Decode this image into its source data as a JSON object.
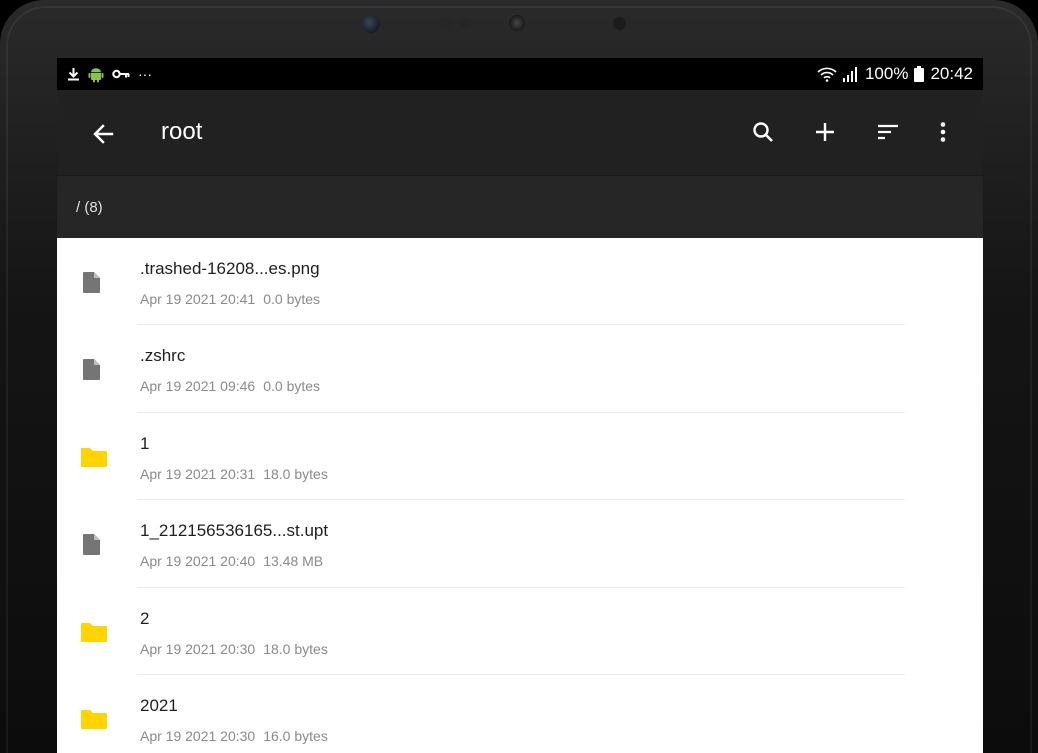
{
  "status_bar": {
    "battery": "100%",
    "time": "20:42",
    "overflow": "···"
  },
  "toolbar": {
    "title": "root"
  },
  "path": {
    "label": "/ (8)"
  },
  "files": [
    {
      "name": ".trashed-16208...es.png",
      "date": "Apr 19 2021 20:41",
      "size": "0.0 bytes",
      "type": "file"
    },
    {
      "name": ".zshrc",
      "date": "Apr 19 2021 09:46",
      "size": "0.0 bytes",
      "type": "file"
    },
    {
      "name": "1",
      "date": "Apr 19 2021 20:31",
      "size": "18.0 bytes",
      "type": "folder"
    },
    {
      "name": "1_212156536165...st.upt",
      "date": "Apr 19 2021 20:40",
      "size": "13.48 MB",
      "type": "file"
    },
    {
      "name": "2",
      "date": "Apr 19 2021 20:30",
      "size": "18.0 bytes",
      "type": "folder"
    },
    {
      "name": "2021",
      "date": "Apr 19 2021 20:30",
      "size": "16.0 bytes",
      "type": "folder"
    }
  ],
  "icons": {
    "back": "arrow-back-icon",
    "search": "search-icon",
    "add": "add-icon",
    "sort": "sort-icon",
    "more": "more-vert-icon",
    "file": "file-icon",
    "folder": "folder-icon"
  },
  "colors": {
    "appbar": "#212121",
    "pathbar": "#262626",
    "folder": "#FFD400",
    "file": "#757575"
  }
}
